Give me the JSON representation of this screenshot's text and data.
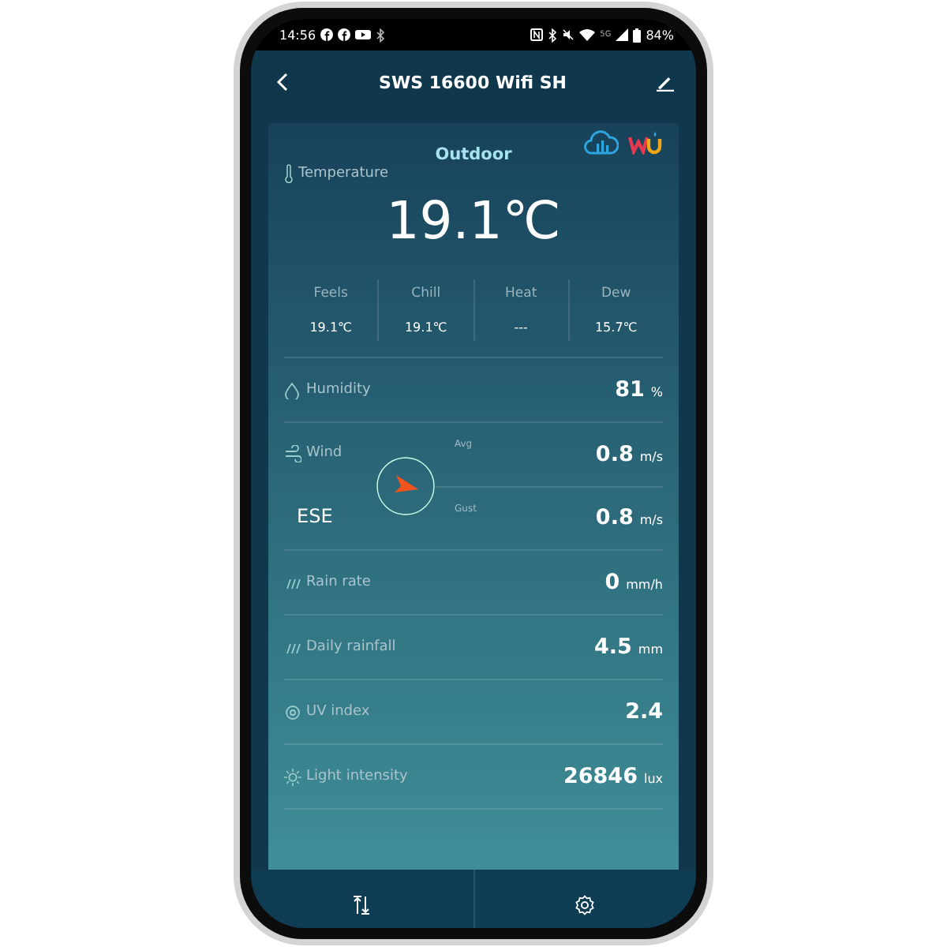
{
  "status_bar": {
    "time": "14:56",
    "network": "5G",
    "battery": "84%"
  },
  "app_bar": {
    "title": "SWS 16600 Wifi SH"
  },
  "card": {
    "title": "Outdoor",
    "temperature": {
      "label": "Temperature",
      "value": "19.1℃"
    },
    "sub_readings": [
      {
        "label": "Feels",
        "value": "19.1℃"
      },
      {
        "label": "Chill",
        "value": "19.1℃"
      },
      {
        "label": "Heat",
        "value": "---"
      },
      {
        "label": "Dew",
        "value": "15.7℃"
      }
    ],
    "rows": [
      {
        "kind": "simple",
        "label": "Humidity",
        "value": "81",
        "unit": "%"
      },
      {
        "kind": "wind",
        "label": "Wind",
        "direction": "ESE",
        "avg_label": "Avg",
        "avg_value": "0.8",
        "avg_unit": "m/s",
        "gust_label": "Gust",
        "gust_value": "0.8",
        "gust_unit": "m/s"
      },
      {
        "kind": "simple",
        "label": "Rain rate",
        "value": "0",
        "unit": "mm/h"
      },
      {
        "kind": "simple",
        "label": "Daily rainfall",
        "value": "4.5",
        "unit": "mm"
      },
      {
        "kind": "simple",
        "label": "UV index",
        "value": "2.4"
      },
      {
        "kind": "simple",
        "label": "Light intensity",
        "value": "26846",
        "unit": "lux"
      }
    ]
  }
}
